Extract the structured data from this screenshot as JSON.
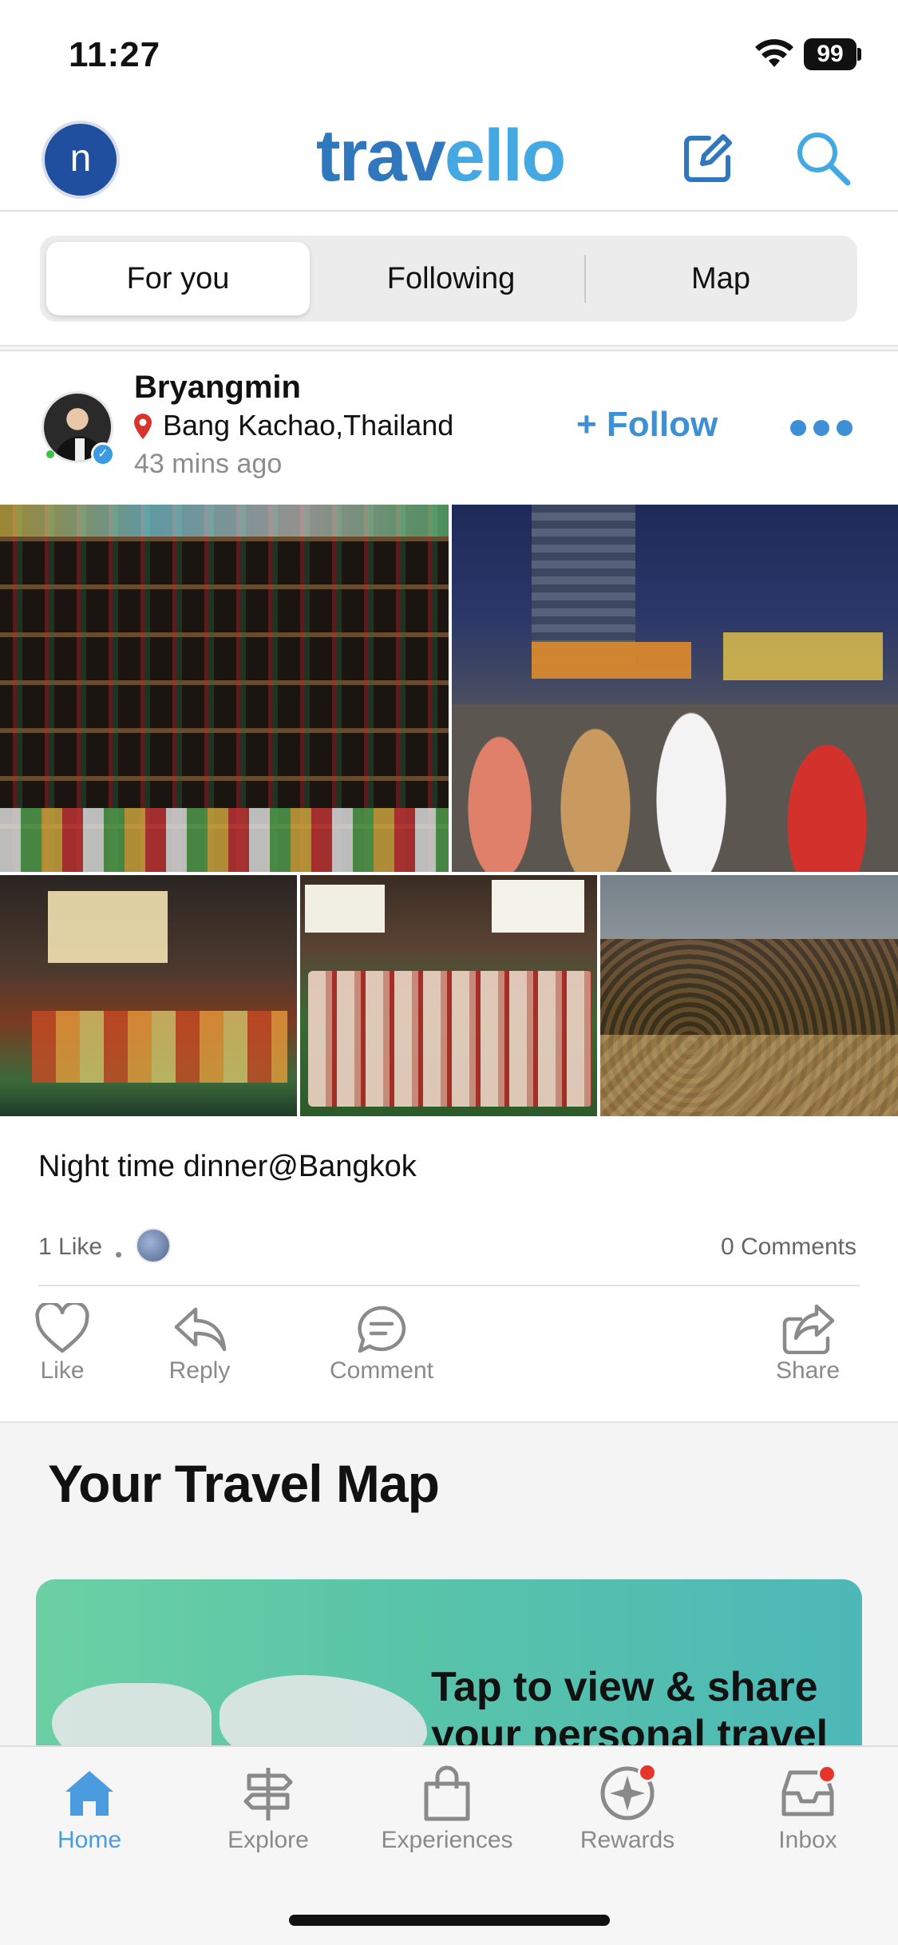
{
  "status": {
    "time": "11:27",
    "battery": "99",
    "icons": [
      "wifi-icon",
      "battery-icon"
    ]
  },
  "header": {
    "avatar_initial": "n",
    "logo_part1": "trav",
    "logo_part2": "ello",
    "icons": [
      "compose-icon",
      "search-icon"
    ],
    "colors": {
      "brand_dark": "#2f78bd",
      "brand_light": "#44a8e3"
    }
  },
  "tabs": [
    {
      "label": "For you",
      "active": true
    },
    {
      "label": "Following",
      "active": false
    },
    {
      "label": "Map",
      "active": false
    }
  ],
  "post": {
    "username": "Bryangmin",
    "location": "Bang Kachao,Thailand",
    "time_ago": "43 mins ago",
    "follow_label": "+ Follow",
    "caption": "Night time dinner@Bangkok",
    "likes": "1 Like",
    "likes_separator": "•",
    "comments": "0 Comments",
    "actions": [
      {
        "label": "Like",
        "icon": "heart-icon"
      },
      {
        "label": "Reply",
        "icon": "reply-icon"
      },
      {
        "label": "Comment",
        "icon": "comment-icon"
      },
      {
        "label": "Share",
        "icon": "share-icon"
      }
    ]
  },
  "travel_map": {
    "title": "Your Travel Map",
    "cta": "Tap to view & share your personal travel"
  },
  "bottom_nav": [
    {
      "label": "Home",
      "icon": "home-icon",
      "active": true
    },
    {
      "label": "Explore",
      "icon": "signpost-icon",
      "active": false
    },
    {
      "label": "Experiences",
      "icon": "bag-icon",
      "active": false
    },
    {
      "label": "Rewards",
      "icon": "rewards-icon",
      "active": false,
      "badge": true
    },
    {
      "label": "Inbox",
      "icon": "inbox-icon",
      "active": false,
      "badge": true
    }
  ],
  "colors": {
    "accent": "#3d8fd6",
    "badge": "#e8352c",
    "pin": "#d9342b"
  }
}
